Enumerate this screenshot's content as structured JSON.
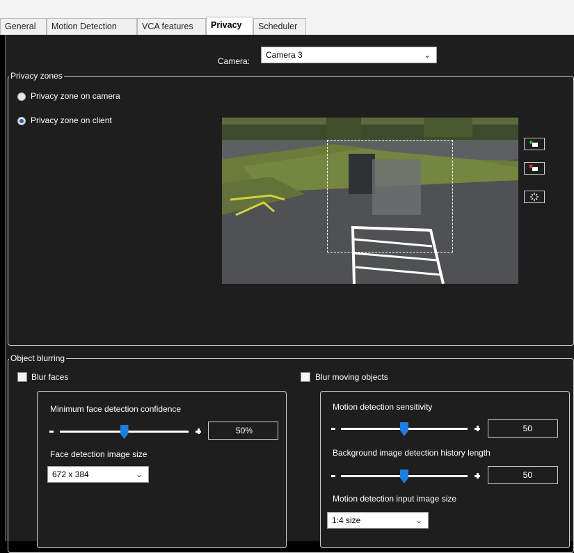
{
  "tabs": [
    {
      "label": "General",
      "active": false
    },
    {
      "label": "Motion Detection",
      "active": false
    },
    {
      "label": "VCA features",
      "active": false
    },
    {
      "label": "Privacy",
      "active": true
    },
    {
      "label": "Scheduler",
      "active": false
    }
  ],
  "camera": {
    "label": "Camera:",
    "value": "Camera 3"
  },
  "privacy_zones": {
    "title": "Privacy zones",
    "options": [
      {
        "label": "Privacy zone on camera",
        "checked": false
      },
      {
        "label": "Privacy zone on client",
        "checked": true
      }
    ],
    "buttons": [
      {
        "icon": "add-zone-icon"
      },
      {
        "icon": "delete-zone-icon"
      },
      {
        "icon": "clear-zones-icon"
      }
    ]
  },
  "object_blurring": {
    "title": "Object blurring",
    "blur_faces": {
      "label": "Blur faces",
      "checked": false,
      "min_confidence_label": "Minimum face detection confidence",
      "min_confidence_value": "50%",
      "min_confidence_level": 0.5,
      "image_size_label": "Face detection image size",
      "image_size_value": "672 x 384"
    },
    "blur_moving": {
      "label": "Blur moving objects",
      "checked": false,
      "sensitivity_label": "Motion detection sensitivity",
      "sensitivity_value": "50",
      "sensitivity_level": 0.5,
      "history_label": "Background image detection history length",
      "history_value": "50",
      "history_level": 0.5,
      "input_size_label": "Motion detection input image size",
      "input_size_value": "1:4 size"
    }
  },
  "colors": {
    "accent": "#1e7ee0",
    "panel": "#1e1e1e",
    "border": "#d0d0d0"
  }
}
